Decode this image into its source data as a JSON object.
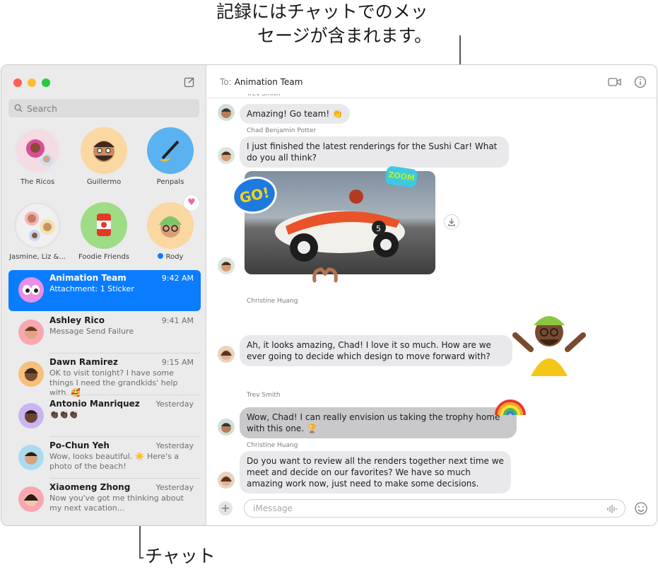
{
  "callouts": {
    "top_line1": "記録にはチャットでのメッ",
    "top_line2": "セージが含まれます。",
    "bottom": "チャット"
  },
  "sidebar": {
    "search_placeholder": "Search",
    "pinned": [
      {
        "label": "The Ricos"
      },
      {
        "label": "Guillermo"
      },
      {
        "label": "Penpals"
      },
      {
        "label": "Jasmine, Liz &..."
      },
      {
        "label": "Foodie Friends"
      },
      {
        "label": "Rody"
      }
    ],
    "conversations": [
      {
        "name": "Animation Team",
        "time": "9:42 AM",
        "preview": "Attachment: 1 Sticker"
      },
      {
        "name": "Ashley Rico",
        "time": "9:41 AM",
        "preview": "Message Send Failure"
      },
      {
        "name": "Dawn Ramirez",
        "time": "9:15 AM",
        "preview": "OK to visit tonight? I have some things I need the grandkids' help with. 🥰"
      },
      {
        "name": "Antonio Manriquez",
        "time": "Yesterday",
        "preview": "👏🏿👏🏿👏🏿"
      },
      {
        "name": "Po-Chun Yeh",
        "time": "Yesterday",
        "preview": "Wow, looks beautiful. ☀️ Here's a photo of the beach!"
      },
      {
        "name": "Xiaomeng Zhong",
        "time": "Yesterday",
        "preview": "Now you've got me thinking about my next vacation..."
      }
    ]
  },
  "header": {
    "to_label": "To:",
    "recipient": "Animation Team"
  },
  "messages": [
    {
      "sender": "Trev Smith",
      "text": "Amazing! Go team! 👏"
    },
    {
      "sender": "Chad Benjamin Potter",
      "text": "I just finished the latest renderings for the Sushi Car! What do you all think?"
    },
    {
      "sender": "Christine Huang",
      "text": "Ah, it looks amazing, Chad! I love it so much. How are we ever going to decide which design to move forward with?"
    },
    {
      "sender": "Trev Smith",
      "text": "Wow, Chad! I can really envision us taking the trophy home with this one. 🏆"
    },
    {
      "sender": "Christine Huang",
      "text": "Do you want to review all the renders together next time we meet and decide on our favorites? We have so much amazing work now, just need to make some decisions."
    }
  ],
  "stickers": {
    "go": "GO!",
    "zoom": "ZOOM"
  },
  "input": {
    "placeholder": "iMessage"
  },
  "colors": {
    "accent": "#0a7cff",
    "sidebar_bg": "#ebebeb",
    "bubble_gray": "#e9e9eb"
  }
}
